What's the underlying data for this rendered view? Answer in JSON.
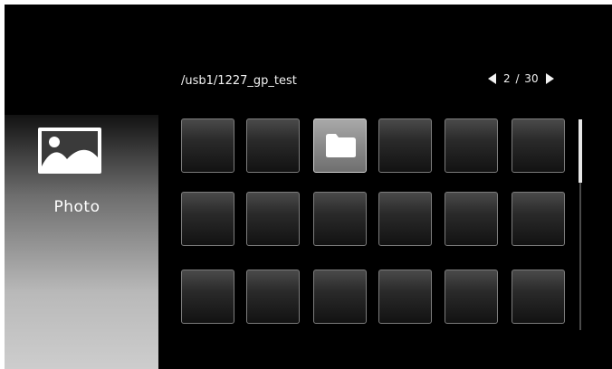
{
  "sidebar": {
    "category_label": "Photo",
    "category_icon": "photo-icon"
  },
  "header": {
    "path": "/usb1/1227_gp_test",
    "page_indicator": "2 / 30",
    "prev_icon": "prev-page-icon",
    "next_icon": "next-page-icon"
  },
  "grid": {
    "rows": 3,
    "columns": 6,
    "tiles": [
      {
        "type": "empty"
      },
      {
        "type": "empty"
      },
      {
        "type": "folder",
        "selected": true
      },
      {
        "type": "empty"
      },
      {
        "type": "empty"
      },
      {
        "type": "empty"
      },
      {
        "type": "empty"
      },
      {
        "type": "empty"
      },
      {
        "type": "empty"
      },
      {
        "type": "empty"
      },
      {
        "type": "empty"
      },
      {
        "type": "empty"
      },
      {
        "type": "empty"
      },
      {
        "type": "empty"
      },
      {
        "type": "empty"
      },
      {
        "type": "empty"
      },
      {
        "type": "empty"
      },
      {
        "type": "empty"
      }
    ]
  },
  "scrollbar": {
    "position_fraction": 0.0,
    "visible_fraction": 0.3
  },
  "colors": {
    "background": "#000000",
    "text": "#f2f2f2",
    "tile_border": "#7d7d7d",
    "selected_tile": "#8a8a8a"
  }
}
